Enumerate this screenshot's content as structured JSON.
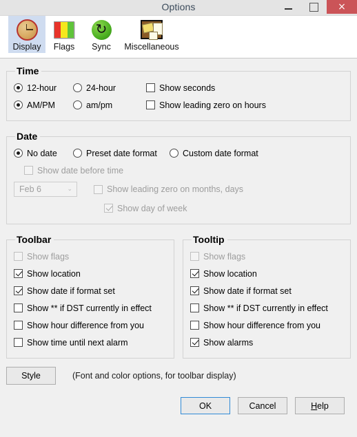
{
  "window": {
    "title": "Options",
    "controls": {
      "minimize": "minimize-button",
      "maximize": "maximize-button",
      "close": "×"
    }
  },
  "tabs": [
    {
      "label": "Display",
      "icon": "clock-icon",
      "selected": true
    },
    {
      "label": "Flags",
      "icon": "flag-icon",
      "selected": false
    },
    {
      "label": "Sync",
      "icon": "sync-icon",
      "selected": false
    },
    {
      "label": "Miscellaneous",
      "icon": "sticky-notes-icon",
      "selected": false
    }
  ],
  "time_group": {
    "legend": "Time",
    "hour_format": [
      {
        "label": "12-hour",
        "checked": true
      },
      {
        "label": "24-hour",
        "checked": false
      }
    ],
    "meridiem_case": [
      {
        "label": "AM/PM",
        "checked": true
      },
      {
        "label": "am/pm",
        "checked": false
      }
    ],
    "show_seconds": {
      "label": "Show seconds",
      "checked": false
    },
    "show_leading_zero_hours": {
      "label": "Show leading zero on hours",
      "checked": false
    }
  },
  "date_group": {
    "legend": "Date",
    "mode": [
      {
        "label": "No date",
        "checked": true
      },
      {
        "label": "Preset date format",
        "checked": false
      },
      {
        "label": "Custom date format",
        "checked": false
      }
    ],
    "show_date_before_time": {
      "label": "Show date before time",
      "checked": false,
      "disabled": true
    },
    "preset_combo": {
      "value": "Feb 6",
      "disabled": true,
      "chevron": "⌄"
    },
    "show_leading_zero_months_days": {
      "label": "Show leading zero on months, days",
      "checked": false,
      "disabled": true
    },
    "show_day_of_week": {
      "label": "Show day of week",
      "checked": true,
      "disabled": true
    }
  },
  "toolbar_group": {
    "legend": "Toolbar",
    "items": [
      {
        "label": "Show flags",
        "checked": false,
        "disabled": true
      },
      {
        "label": "Show location",
        "checked": true,
        "disabled": false
      },
      {
        "label": "Show date if format set",
        "checked": true,
        "disabled": false
      },
      {
        "label": "Show ** if DST currently in effect",
        "checked": false,
        "disabled": false
      },
      {
        "label": "Show hour difference from you",
        "checked": false,
        "disabled": false
      },
      {
        "label": "Show time until next alarm",
        "checked": false,
        "disabled": false
      }
    ]
  },
  "tooltip_group": {
    "legend": "Tooltip",
    "items": [
      {
        "label": "Show flags",
        "checked": false,
        "disabled": true
      },
      {
        "label": "Show location",
        "checked": true,
        "disabled": false
      },
      {
        "label": "Show date if format set",
        "checked": true,
        "disabled": false
      },
      {
        "label": "Show ** if DST currently in effect",
        "checked": false,
        "disabled": false
      },
      {
        "label": "Show hour difference from you",
        "checked": false,
        "disabled": false
      },
      {
        "label": "Show alarms",
        "checked": true,
        "disabled": false
      }
    ]
  },
  "footer": {
    "style_button": "Style",
    "style_note": "(Font and color options, for toolbar display)",
    "ok": "OK",
    "cancel": "Cancel",
    "help_accel": "H",
    "help_rest": "elp"
  },
  "colors": {
    "titlebar_bg": "#e4e4e4",
    "close_btn": "#cb5458",
    "tab_selected": "#cfdcf0",
    "dialog_bg": "#f0f0f0",
    "default_button_border": "#2f8ad6",
    "flag_red": "#e8342a",
    "flag_yellow": "#f5e71c",
    "flag_green": "#5fc43a",
    "sync_green": "#4cb022"
  }
}
